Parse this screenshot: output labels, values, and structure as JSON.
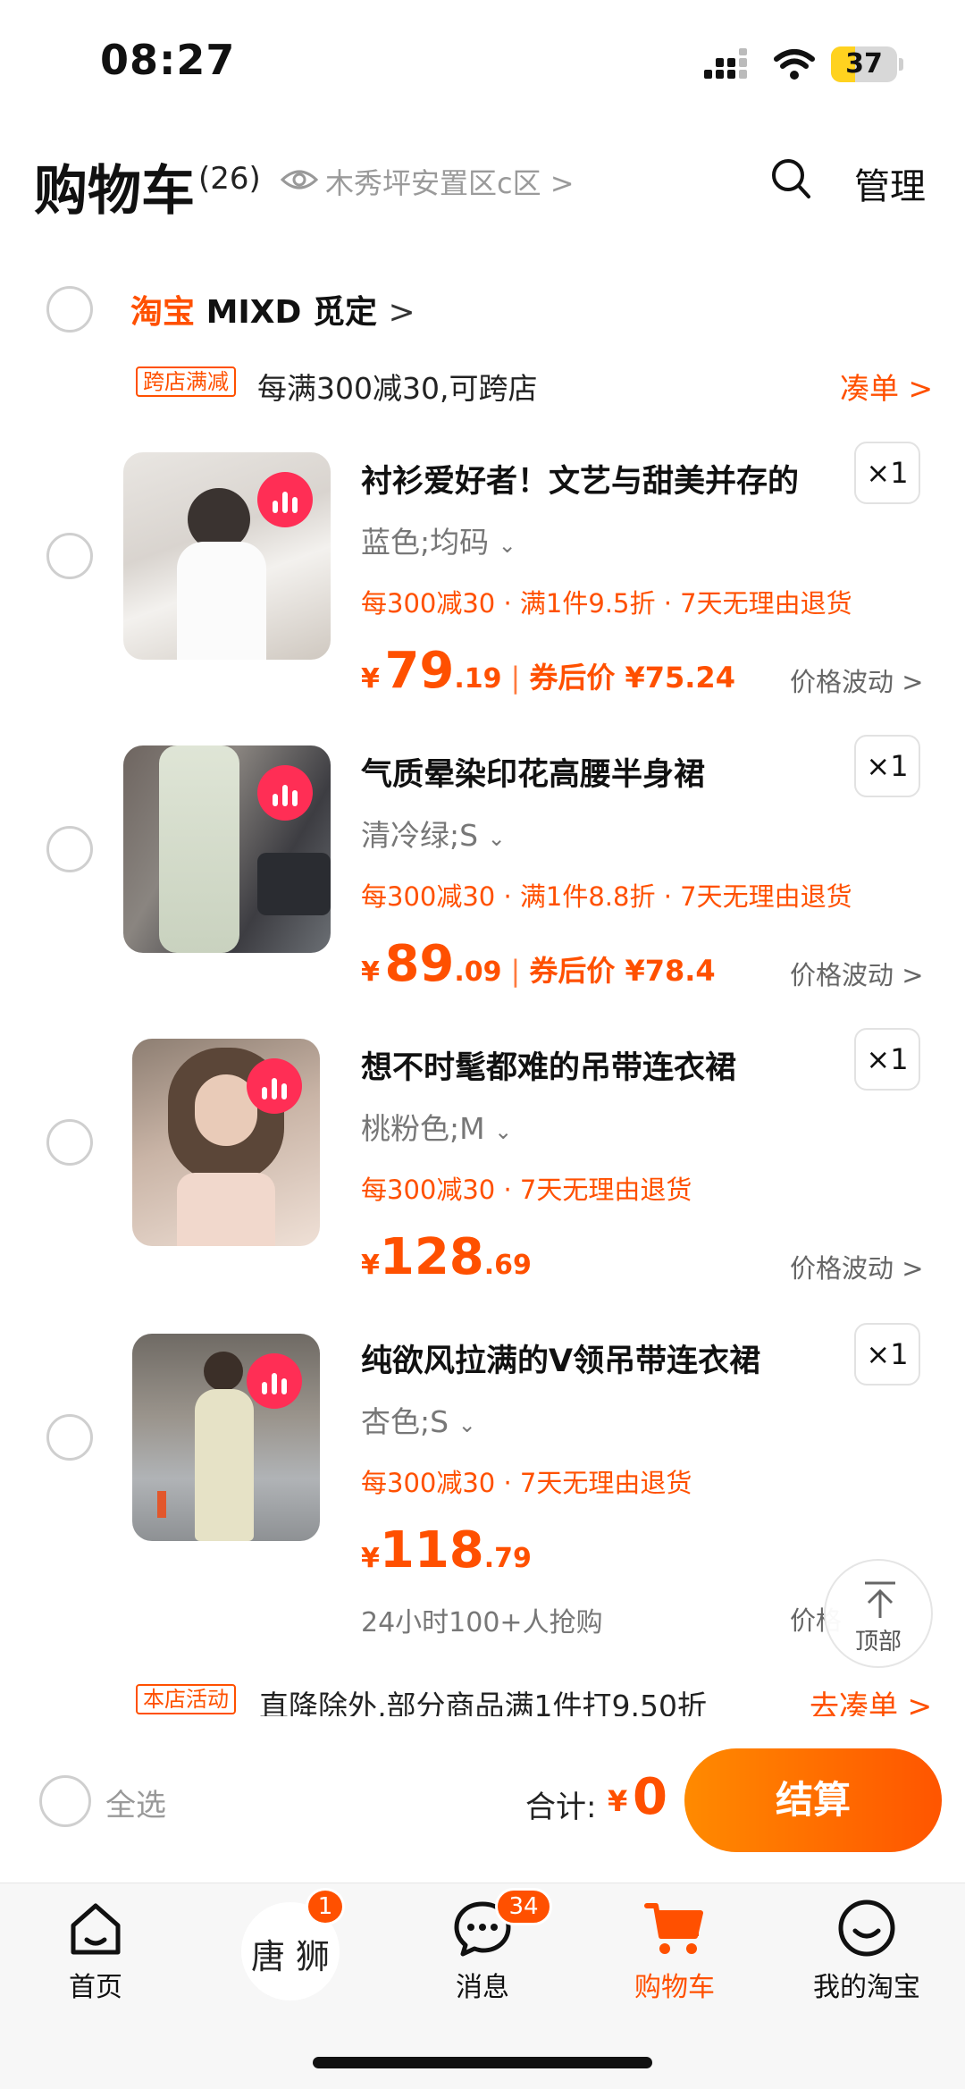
{
  "status_bar": {
    "time": "08:27",
    "battery": "37",
    "battery_level": 0.37
  },
  "header": {
    "title": "购物车",
    "count": "(26)",
    "location": "木秀坪安置区c区 >",
    "manage": "管理"
  },
  "store": {
    "brand": "淘宝",
    "name": "MIXD 觅定",
    "chevron": ">",
    "promo_tag": "跨店满减",
    "promo_text": "每满300减30,可跨店",
    "promo_link": "凑单 >"
  },
  "items": [
    {
      "title": "衬衫爱好者！文艺与甜美并存的",
      "qty": "×1",
      "sku": "蓝色;均码",
      "promo": "每300减30 · 满1件9.5折 · 7天无理由退货",
      "yen": "¥",
      "price_int": "79",
      "price_dec": ".19",
      "sep": "|",
      "coupon": "券后价 ¥75.24",
      "wave": "价格波动 >"
    },
    {
      "title": "气质晕染印花高腰半身裙",
      "qty": "×1",
      "sku": "清冷绿;S",
      "promo": "每300减30 · 满1件8.8折 · 7天无理由退货",
      "yen": "¥",
      "price_int": "89",
      "price_dec": ".09",
      "sep": "|",
      "coupon": "券后价 ¥78.4",
      "wave": "价格波动 >"
    },
    {
      "title": "想不时髦都难的吊带连衣裙",
      "qty": "×1",
      "sku": "桃粉色;M",
      "promo": "每300减30 · 7天无理由退货",
      "yen": "¥",
      "price_int": "128",
      "price_dec": ".69",
      "wave": "价格波动 >"
    },
    {
      "title": "纯欲风拉满的V领吊带连衣裙",
      "qty": "×1",
      "sku": "杏色;S",
      "promo": "每300减30 · 7天无理由退货",
      "yen": "¥",
      "price_int": "118",
      "price_dec": ".79",
      "hot": "24小时100+人抢购",
      "wave": "价格"
    }
  ],
  "back_to_top": "顶部",
  "store_activity": {
    "tag": "本店活动",
    "text": "直降除外,部分商品满1件打9.50折",
    "link": "去凑单 >"
  },
  "checkout": {
    "select_all": "全选",
    "total_label": "合计:",
    "total_yen": "¥",
    "total_value": "0",
    "pay": "结算"
  },
  "tabbar": {
    "home": "首页",
    "tangshi": "唐 狮",
    "tangshi_badge": "1",
    "messages": "消息",
    "messages_badge": "34",
    "cart": "购物车",
    "mine": "我的淘宝"
  },
  "colors": {
    "accent": "#ff5000",
    "badge_red": "#ff2e55"
  }
}
